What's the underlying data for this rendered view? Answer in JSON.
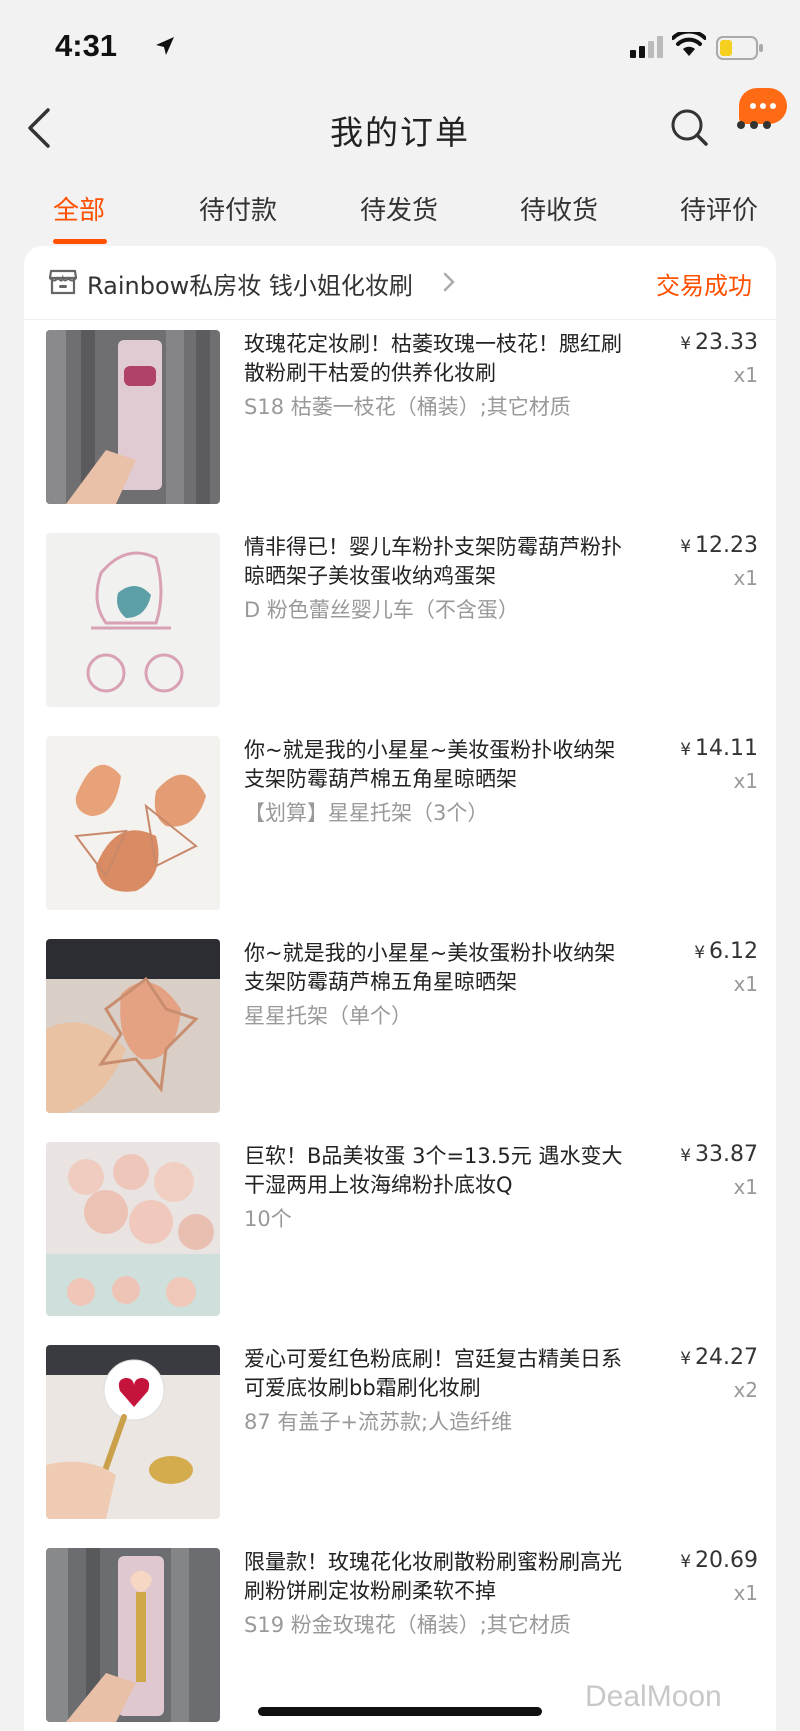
{
  "status_bar": {
    "time": "4:31"
  },
  "nav": {
    "title": "我的订单"
  },
  "tabs": [
    {
      "label": "全部",
      "active": true
    },
    {
      "label": "待付款"
    },
    {
      "label": "待发货"
    },
    {
      "label": "待收货"
    },
    {
      "label": "待评价"
    }
  ],
  "order": {
    "store_name": "Rainbow私房妆 钱小姐化妆刷",
    "status": "交易成功",
    "currency": "¥",
    "items": [
      {
        "title": "玫瑰花定妆刷！枯萎玫瑰一枝花！腮红刷散粉刷干枯爱的供养化妆刷",
        "sku": "S18 枯萎一枝花（桶装）;其它材质",
        "price": "23.33",
        "qty": "x1"
      },
      {
        "title": "情非得已！婴儿车粉扑支架防霉葫芦粉扑晾晒架子美妆蛋收纳鸡蛋架",
        "sku": "D 粉色蕾丝婴儿车（不含蛋）",
        "price": "12.23",
        "qty": "x1"
      },
      {
        "title": "你~就是我的小星星~美妆蛋粉扑收纳架支架防霉葫芦棉五角星晾晒架",
        "sku": "【划算】星星托架（3个）",
        "price": "14.11",
        "qty": "x1"
      },
      {
        "title": "你~就是我的小星星~美妆蛋粉扑收纳架支架防霉葫芦棉五角星晾晒架",
        "sku": "星星托架（单个）",
        "price": "6.12",
        "qty": "x1"
      },
      {
        "title": "巨软！B品美妆蛋 3个=13.5元 遇水变大干湿两用上妆海绵粉扑底妆Q",
        "sku": "10个",
        "price": "33.87",
        "qty": "x1"
      },
      {
        "title": "爱心可爱红色粉底刷！宫廷复古精美日系可爱底妆刷bb霜刷化妆刷",
        "sku": "87  有盖子+流苏款;人造纤维",
        "price": "24.27",
        "qty": "x2"
      },
      {
        "title": "限量款！玫瑰花化妆刷散粉刷蜜粉刷高光刷粉饼刷定妆粉刷柔软不掉",
        "sku": "S19 粉金玫瑰花（桶装）;其它材质",
        "price": "20.69",
        "qty": "x1"
      }
    ]
  },
  "watermark": "DealMoon",
  "colors": {
    "accent": "#ff5000",
    "background": "#f2f2f2"
  }
}
